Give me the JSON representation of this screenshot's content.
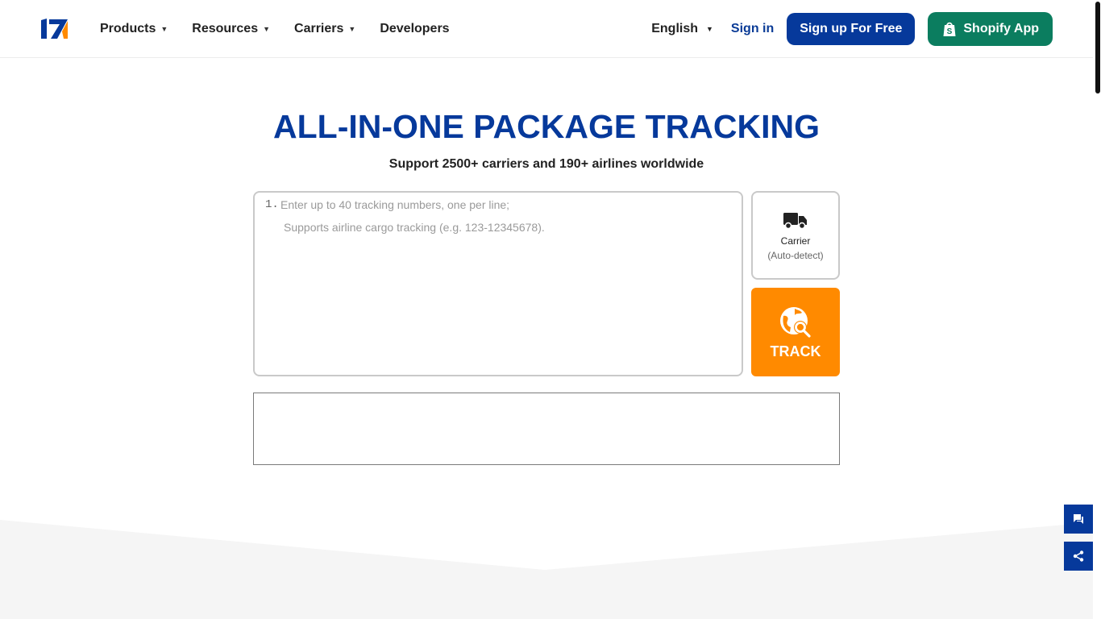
{
  "header": {
    "logo_text": "17",
    "nav": [
      {
        "label": "Products",
        "has_dropdown": true
      },
      {
        "label": "Resources",
        "has_dropdown": true
      },
      {
        "label": "Carriers",
        "has_dropdown": true
      },
      {
        "label": "Developers",
        "has_dropdown": false
      }
    ],
    "language": "English",
    "signin": "Sign in",
    "signup": "Sign up For Free",
    "shopify": "Shopify App"
  },
  "hero": {
    "title": "ALL-IN-ONE PACKAGE TRACKING",
    "subtitle": "Support 2500+ carriers and 190+ airlines worldwide"
  },
  "tracker": {
    "line_number": "1.",
    "placeholder_line1": "Enter up to 40 tracking numbers, one per line;",
    "placeholder_line2": "Supports airline cargo tracking (e.g. 123-12345678).",
    "carrier_label": "Carrier",
    "carrier_sub": "(Auto-detect)",
    "track_label": "TRACK"
  },
  "colors": {
    "brand_blue": "#06399b",
    "track_orange": "#ff8a00",
    "shopify_green": "#0b7d5f"
  },
  "icons": {
    "carrier": "truck-icon",
    "track": "globe-search-icon",
    "shopify": "shopify-bag-icon",
    "feedback": "chat-icon",
    "share": "share-icon"
  }
}
